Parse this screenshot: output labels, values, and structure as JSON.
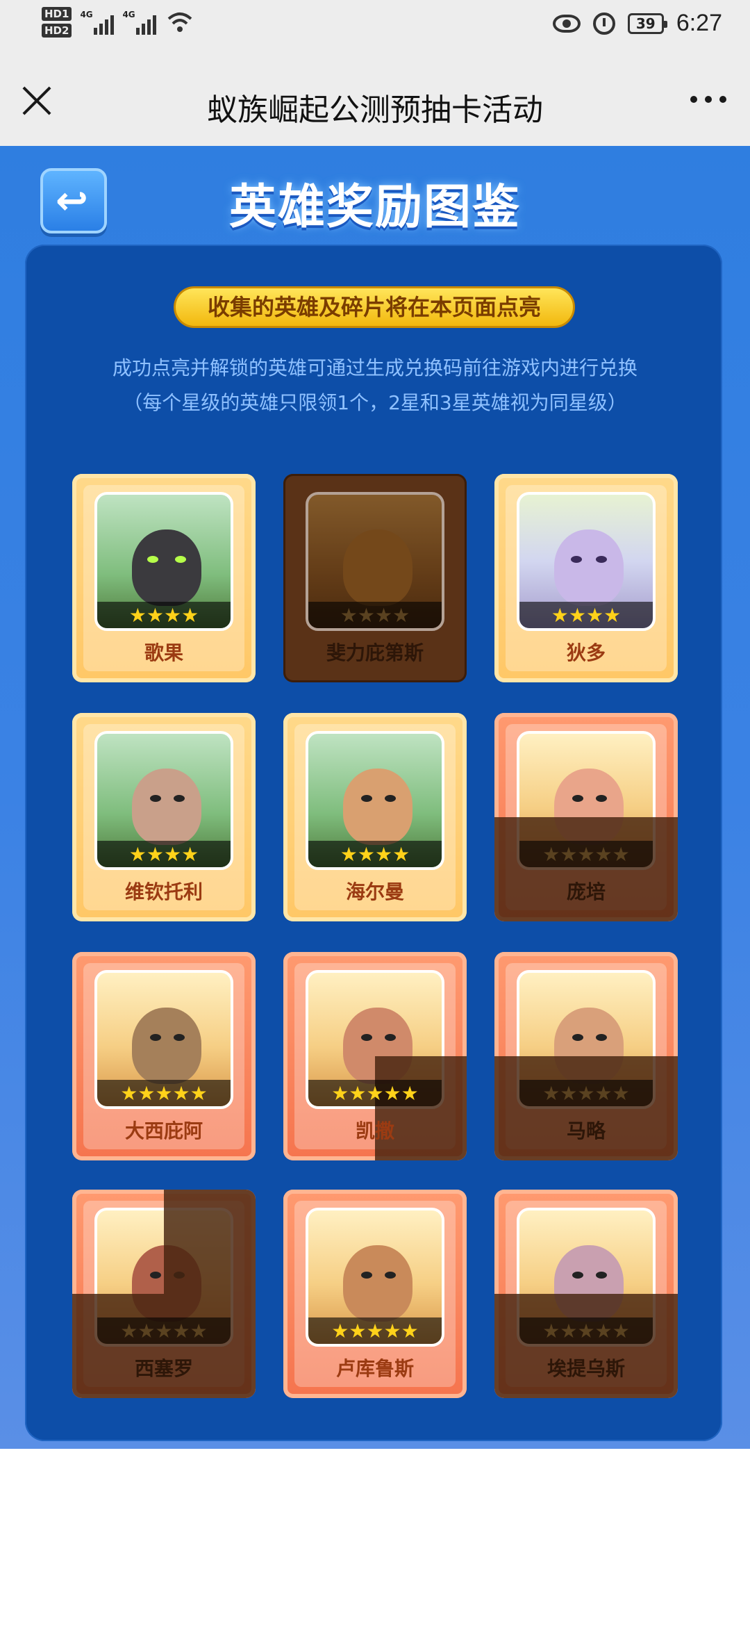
{
  "status_bar": {
    "hd1": "HD1",
    "hd2": "HD2",
    "net1": "4G",
    "net2": "4G",
    "battery": "39",
    "time": "6:27"
  },
  "nav": {
    "title": "蚁族崛起公测预抽卡活动"
  },
  "game": {
    "heading": "英雄奖励图鉴",
    "back_icon": "↩",
    "notice": "收集的英雄及碎片将在本页面点亮",
    "description": "成功点亮并解锁的英雄可通过生成兑换码前往游戏内进行兑换（每个星级的英雄只限领1个，2星和3星英雄视为同星级）"
  },
  "heroes": [
    {
      "name": "歌果",
      "stars": "★★★★"
    },
    {
      "name": "斐力庇第斯",
      "stars": "★★★★"
    },
    {
      "name": "狄多",
      "stars": "★★★★"
    },
    {
      "name": "维钦托利",
      "stars": "★★★★"
    },
    {
      "name": "海尔曼",
      "stars": "★★★★"
    },
    {
      "name": "庞培",
      "stars": "★★★★★"
    },
    {
      "name": "大西庇阿",
      "stars": "★★★★★"
    },
    {
      "name": "凯撒",
      "stars": "★★★★★"
    },
    {
      "name": "马略",
      "stars": "★★★★★"
    },
    {
      "name": "西塞罗",
      "stars": "★★★★★"
    },
    {
      "name": "卢库鲁斯",
      "stars": "★★★★★"
    },
    {
      "name": "埃提乌斯",
      "stars": "★★★★★"
    }
  ]
}
